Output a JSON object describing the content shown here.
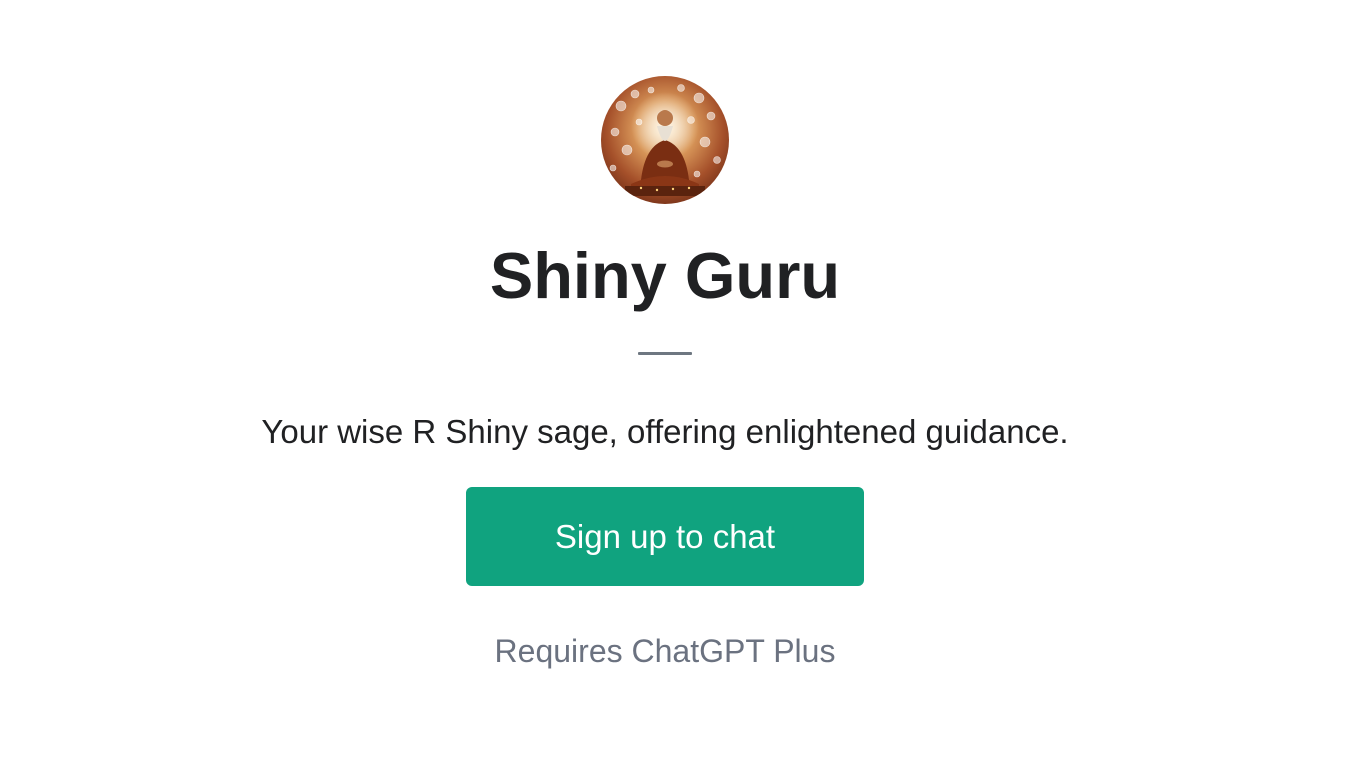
{
  "gpt": {
    "avatar_icon": "meditating-sage-avatar",
    "name": "Shiny Guru",
    "description": "Your wise R Shiny sage, offering enlightened guidance."
  },
  "cta": {
    "label": "Sign up to chat",
    "color": "#10a37f"
  },
  "footer": {
    "requirement": "Requires ChatGPT Plus"
  }
}
